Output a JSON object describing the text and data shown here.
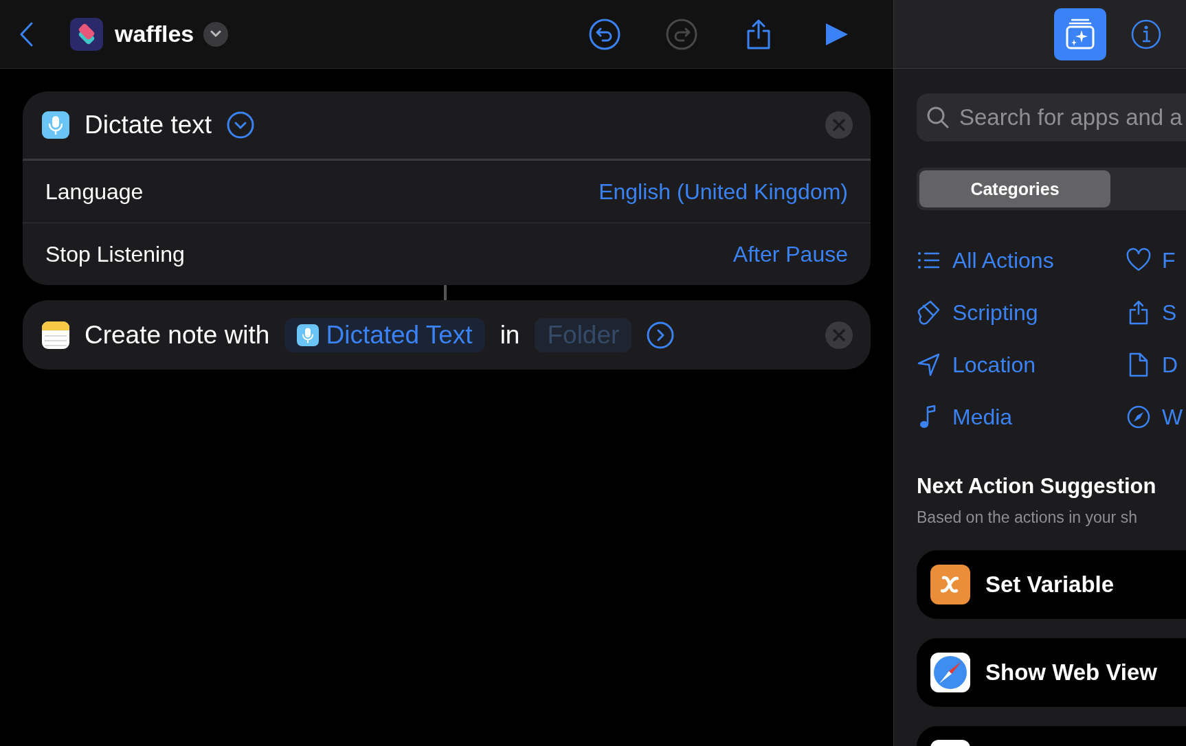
{
  "toolbar": {
    "title": "waffles",
    "buttons": [
      {
        "kind": "undo",
        "disabled": false
      },
      {
        "kind": "redo",
        "disabled": true
      },
      {
        "kind": "share",
        "disabled": false
      },
      {
        "kind": "play",
        "disabled": false
      }
    ]
  },
  "actions": [
    {
      "kind": "parameters",
      "title": "Dictate text",
      "expanded": true,
      "rows": [
        {
          "label": "Language",
          "value": "English (United Kingdom)"
        },
        {
          "label": "Stop Listening",
          "value": "After Pause"
        }
      ]
    },
    {
      "kind": "sentence",
      "expanded": false,
      "parts": [
        {
          "kind": "text",
          "text": "Create note with"
        },
        {
          "kind": "variable",
          "text": "Dictated Text"
        },
        {
          "kind": "text",
          "text": "in"
        },
        {
          "kind": "placeholder",
          "text": "Folder"
        }
      ]
    }
  ],
  "panel": {
    "tabs": [
      {
        "kind": "library",
        "selected": true
      },
      {
        "kind": "info",
        "selected": false
      }
    ],
    "search": {
      "placeholder": "Search for apps and a"
    },
    "segments": [
      {
        "label": "Categories",
        "selected": true
      }
    ],
    "categories": [
      {
        "label": "All Actions"
      },
      {
        "label": "F"
      },
      {
        "label": "Scripting"
      },
      {
        "label": "S"
      },
      {
        "label": "Location"
      },
      {
        "label": "D"
      },
      {
        "label": "Media"
      },
      {
        "label": "W"
      }
    ],
    "suggestions_title": "Next Action Suggestion",
    "suggestions_subtitle": "Based on the actions in your sh",
    "suggestions": [
      {
        "kind": "variable",
        "name": "Set Variable"
      },
      {
        "kind": "safari",
        "name": "Show Web View"
      }
    ]
  }
}
